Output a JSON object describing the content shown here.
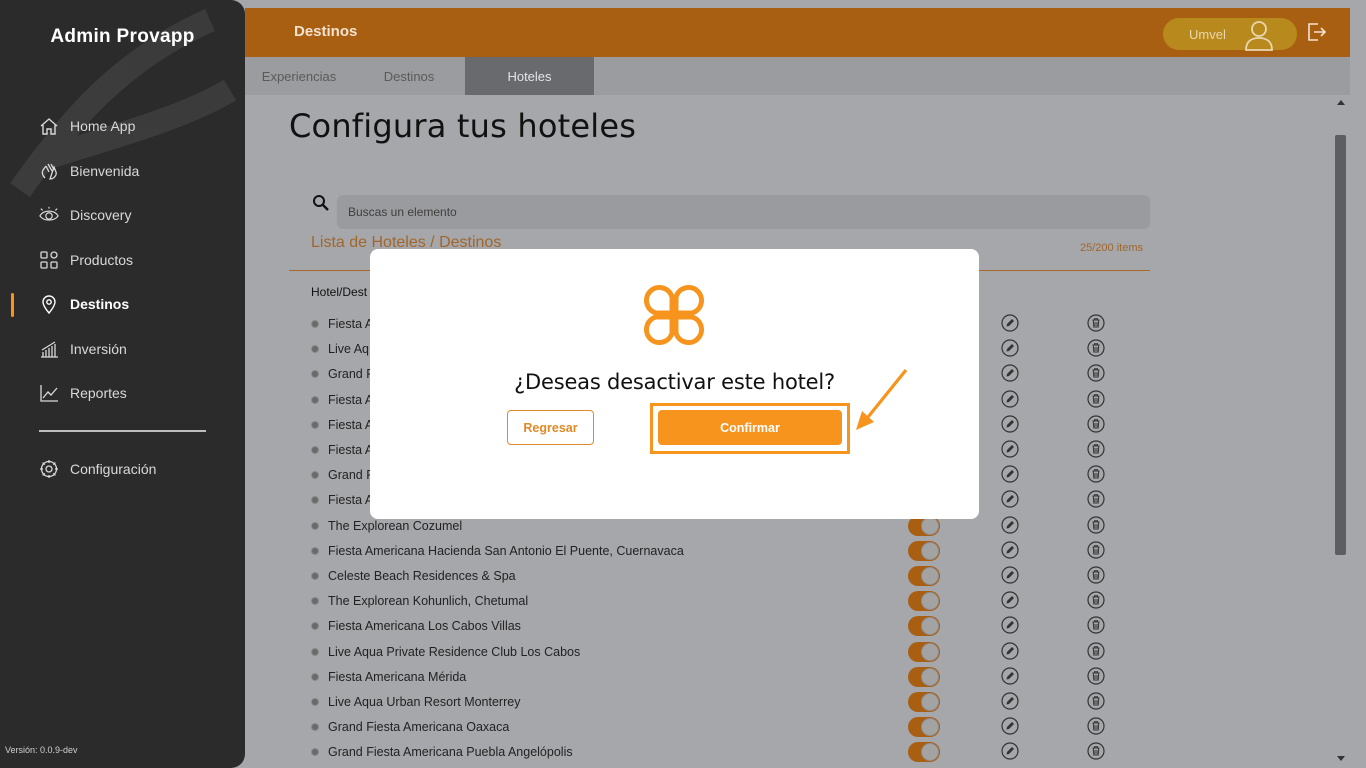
{
  "sidebar": {
    "brand": "Admin Provapp",
    "items": [
      {
        "label": "Home App",
        "icon": "home-icon"
      },
      {
        "label": "Bienvenida",
        "icon": "wave-hand-icon"
      },
      {
        "label": "Discovery",
        "icon": "eye-icon"
      },
      {
        "label": "Productos",
        "icon": "grid-icon"
      },
      {
        "label": "Destinos",
        "icon": "location-pin-icon",
        "active": true
      },
      {
        "label": "Inversión",
        "icon": "bar-chart-icon"
      },
      {
        "label": "Reportes",
        "icon": "line-chart-icon"
      }
    ],
    "config_label": "Configuración",
    "version": "Versión: 0.0.9-dev"
  },
  "header": {
    "title": "Destinos",
    "user_name": "Umvel"
  },
  "tabs": [
    {
      "label": "Experiencias",
      "active": false
    },
    {
      "label": "Destinos",
      "active": false
    },
    {
      "label": "Hoteles",
      "active": true
    }
  ],
  "main": {
    "title": "Configura tus hoteles",
    "search_placeholder": "Buscas un elemento",
    "list_title": "Lista de Hoteles / Destinos",
    "list_count": "25/200 items",
    "column_header": "Hotel/Dest"
  },
  "hotels": [
    {
      "name": "Fiesta A"
    },
    {
      "name": "Live Aq"
    },
    {
      "name": "Grand F"
    },
    {
      "name": "Fiesta A"
    },
    {
      "name": "Fiesta A"
    },
    {
      "name": "Fiesta A"
    },
    {
      "name": "Grand F"
    },
    {
      "name": "Fiesta A"
    },
    {
      "name": "The Explorean Cozumel"
    },
    {
      "name": "Fiesta Americana Hacienda San Antonio El Puente, Cuernavaca"
    },
    {
      "name": "Celeste Beach Residences & Spa"
    },
    {
      "name": "The Explorean Kohunlich, Chetumal"
    },
    {
      "name": "Fiesta Americana Los Cabos Villas"
    },
    {
      "name": "Live Aqua Private Residence Club Los Cabos"
    },
    {
      "name": "Fiesta Americana Mérida"
    },
    {
      "name": "Live Aqua Urban Resort Monterrey"
    },
    {
      "name": "Grand Fiesta Americana Oaxaca"
    },
    {
      "name": "Grand Fiesta Americana Puebla Angelópolis"
    }
  ],
  "modal": {
    "question": "¿Deseas desactivar este hotel?",
    "back_label": "Regresar",
    "confirm_label": "Confirmar",
    "accent": "#f7941d"
  },
  "colors": {
    "sidebar_bg": "#2b2b2b",
    "header_bg": "#a95f12",
    "accent": "#f7941d"
  }
}
